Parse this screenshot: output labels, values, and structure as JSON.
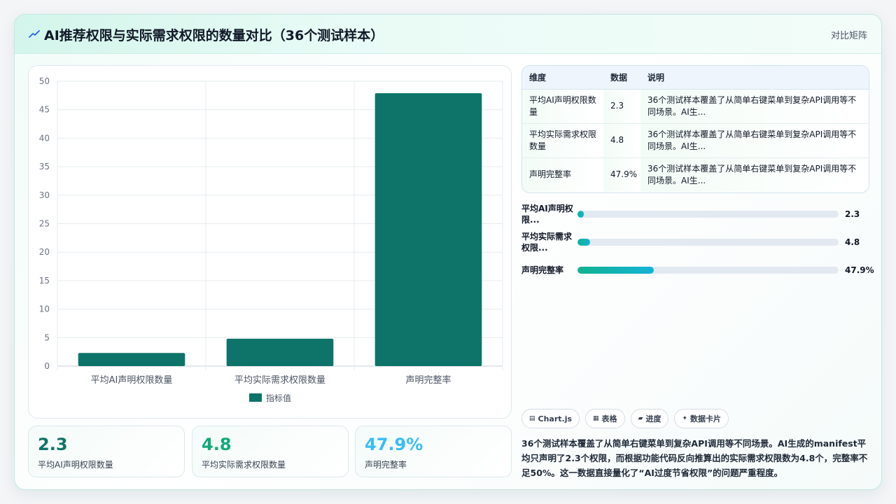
{
  "header": {
    "title": "AI推荐权限与实际需求权限的数量对比（36个测试样本）",
    "link_label": "对比矩阵",
    "icon": "trend-line-icon"
  },
  "chart_data": {
    "type": "bar",
    "categories": [
      "平均AI声明权限数量",
      "平均实际需求权限数量",
      "声明完整率"
    ],
    "series": [
      {
        "name": "指标值",
        "values": [
          2.3,
          4.8,
          47.9
        ]
      }
    ],
    "ylim": [
      0,
      50
    ],
    "yticks": [
      0,
      5,
      10,
      15,
      20,
      25,
      30,
      35,
      40,
      45,
      50
    ],
    "grid": true,
    "legend": "bottom",
    "color": "#0e7469"
  },
  "stats": [
    {
      "value": "2.3",
      "label": "平均AI声明权限数量",
      "color": "#0e7469"
    },
    {
      "value": "4.8",
      "label": "平均实际需求权限数量",
      "color": "#12a97a"
    },
    {
      "value": "47.9%",
      "label": "声明完整率",
      "color": "#38bdf8"
    }
  ],
  "table": {
    "headers": [
      "维度",
      "数据",
      "说明"
    ],
    "rows": [
      [
        "平均AI声明权限数量",
        "2.3",
        "36个测试样本覆盖了从简单右键菜单到复杂API调用等不同场景。AI生..."
      ],
      [
        "平均实际需求权限数量",
        "4.8",
        "36个测试样本覆盖了从简单右键菜单到复杂API调用等不同场景。AI生..."
      ],
      [
        "声明完整率",
        "47.9%",
        "36个测试样本覆盖了从简单右键菜单到复杂API调用等不同场景。AI生..."
      ]
    ]
  },
  "progress": [
    {
      "label": "平均AI声明权限...",
      "value": "2.3",
      "fraction": 0.023
    },
    {
      "label": "平均实际需求权限...",
      "value": "4.8",
      "fraction": 0.048
    },
    {
      "label": "声明完整率",
      "value": "47.9%",
      "fraction": 0.293
    }
  ],
  "chips": [
    {
      "icon": "chart-icon",
      "glyph": "▤",
      "label": "Chart.js"
    },
    {
      "icon": "table-icon",
      "glyph": "▦",
      "label": "表格"
    },
    {
      "icon": "progress-icon",
      "glyph": "▰",
      "label": "进度"
    },
    {
      "icon": "sparkle-icon",
      "glyph": "✦",
      "label": "数据卡片"
    }
  ],
  "description": "36个测试样本覆盖了从简单右键菜单到复杂API调用等不同场景。AI生成的manifest平均只声明了2.3个权限，而根据功能代码反向推算出的实际需求权限数为4.8个，完整率不足50%。这一数据直接量化了“AI过度节省权限”的问题严重程度。"
}
